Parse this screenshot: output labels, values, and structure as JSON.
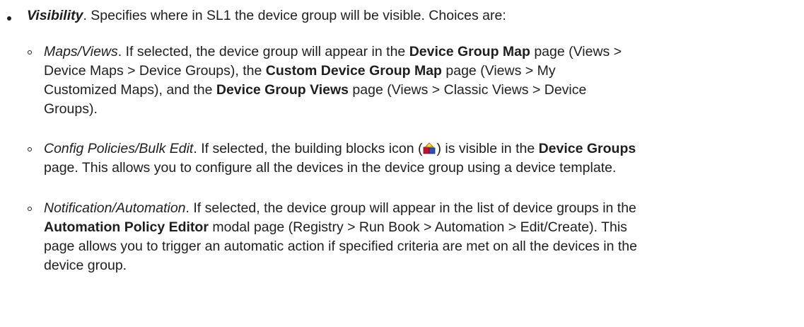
{
  "visibility": {
    "term": "Visibility",
    "intro": ". Specifies where in SL1 the device group will be visible. Choices are:"
  },
  "options": [
    {
      "term": "Maps/Views",
      "lines": [
        [
          {
            "t": ". If selected, the device group will appear in the ",
            "s": "n"
          },
          {
            "t": "Device Group Map",
            "s": "b"
          },
          {
            "t": " page (Views >",
            "s": "n"
          }
        ],
        [
          {
            "t": "Device Maps > Device Groups), the ",
            "s": "n"
          },
          {
            "t": "Custom Device Group Map",
            "s": "b"
          },
          {
            "t": " page (Views > My",
            "s": "n"
          }
        ],
        [
          {
            "t": "Customized Maps), and the ",
            "s": "n"
          },
          {
            "t": "Device Group Views",
            "s": "b"
          },
          {
            "t": " page (Views > Classic Views > Device",
            "s": "n"
          }
        ],
        [
          {
            "t": "Groups).",
            "s": "n"
          }
        ]
      ]
    },
    {
      "term": "Config Policies/Bulk Edit",
      "icon": "building-blocks-icon",
      "lines": [
        [
          {
            "t": ". If selected, the building blocks icon (",
            "s": "n"
          },
          {
            "t": "",
            "s": "icon"
          },
          {
            "t": ") is visible in the ",
            "s": "n"
          },
          {
            "t": "Device Groups",
            "s": "b"
          }
        ],
        [
          {
            "t": "page. This allows you to configure all the devices in the device group using a device template.",
            "s": "n"
          }
        ]
      ]
    },
    {
      "term": "Notification/Automation",
      "lines": [
        [
          {
            "t": ". If selected, the device group will appear in the list of device groups in the",
            "s": "n"
          }
        ],
        [
          {
            "t": "Automation Policy Editor",
            "s": "b"
          },
          {
            "t": " modal page (Registry > Run Book > Automation > Edit/Create). This",
            "s": "n"
          }
        ],
        [
          {
            "t": "page allows you to trigger an automatic action if specified criteria are met on all the devices in the",
            "s": "n"
          }
        ],
        [
          {
            "t": "device group.",
            "s": "n"
          }
        ]
      ]
    }
  ]
}
